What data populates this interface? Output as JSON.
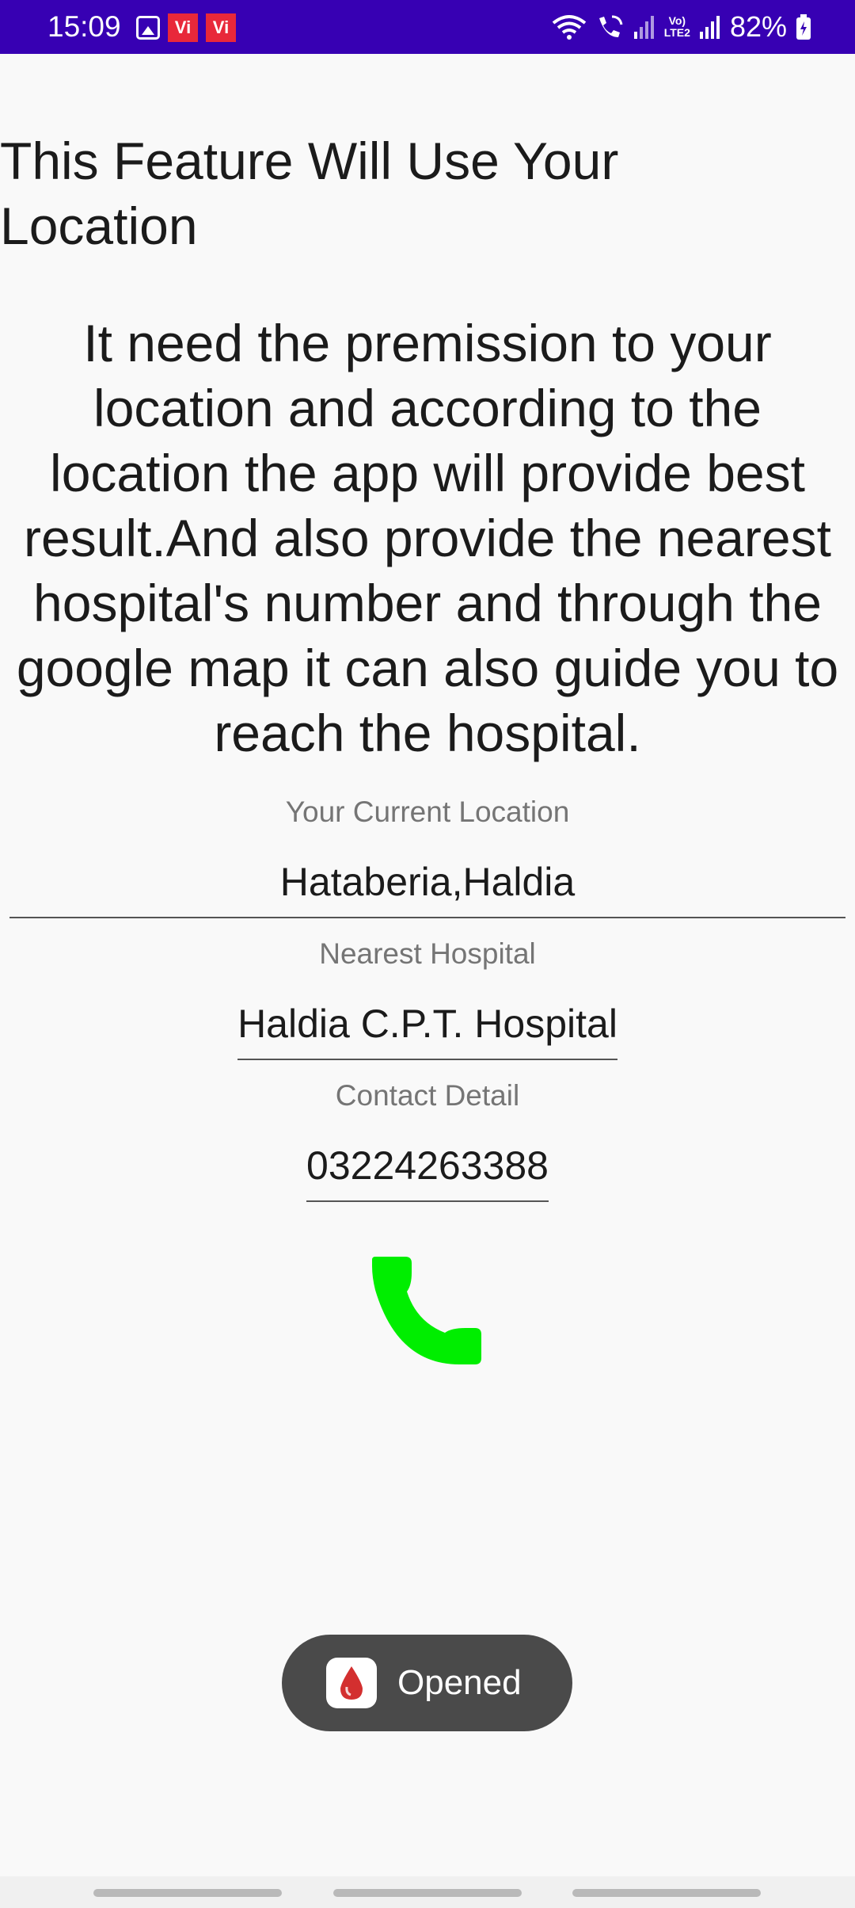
{
  "status_bar": {
    "time": "15:09",
    "left_icons": [
      "gallery-icon",
      "vi-icon",
      "vi-icon"
    ],
    "vi_label": "Vi",
    "right_icons": [
      "wifi-icon",
      "wifi-calling-icon",
      "signal-icon",
      "volte-icon",
      "signal-icon",
      "battery-icon"
    ],
    "volte_line1": "Vo)",
    "volte_line2": "LTE2",
    "battery_percent": "82%",
    "background_color": "#3700b3"
  },
  "heading": "This Feature Will Use Your Location",
  "description": "It need the premission to your location and according to the location the app will provide best result.And also provide the nearest hospital's number and through the google map it can also guide you to reach the hospital.",
  "location": {
    "label": "Your Current Location",
    "value": "Hataberia,Haldia"
  },
  "hospital": {
    "label": "Nearest Hospital",
    "value": "Haldia C.P.T. Hospital"
  },
  "contact": {
    "label": "Contact Detail",
    "value": "03224263388"
  },
  "call_button": {
    "icon": "phone-icon",
    "color": "#00ee00"
  },
  "toast": {
    "icon": "blood-drop-icon",
    "text": "Opened",
    "icon_color": "#d32f2f"
  },
  "nav_bar": {
    "pills": [
      "nav-handle",
      "nav-handle",
      "nav-handle"
    ]
  }
}
